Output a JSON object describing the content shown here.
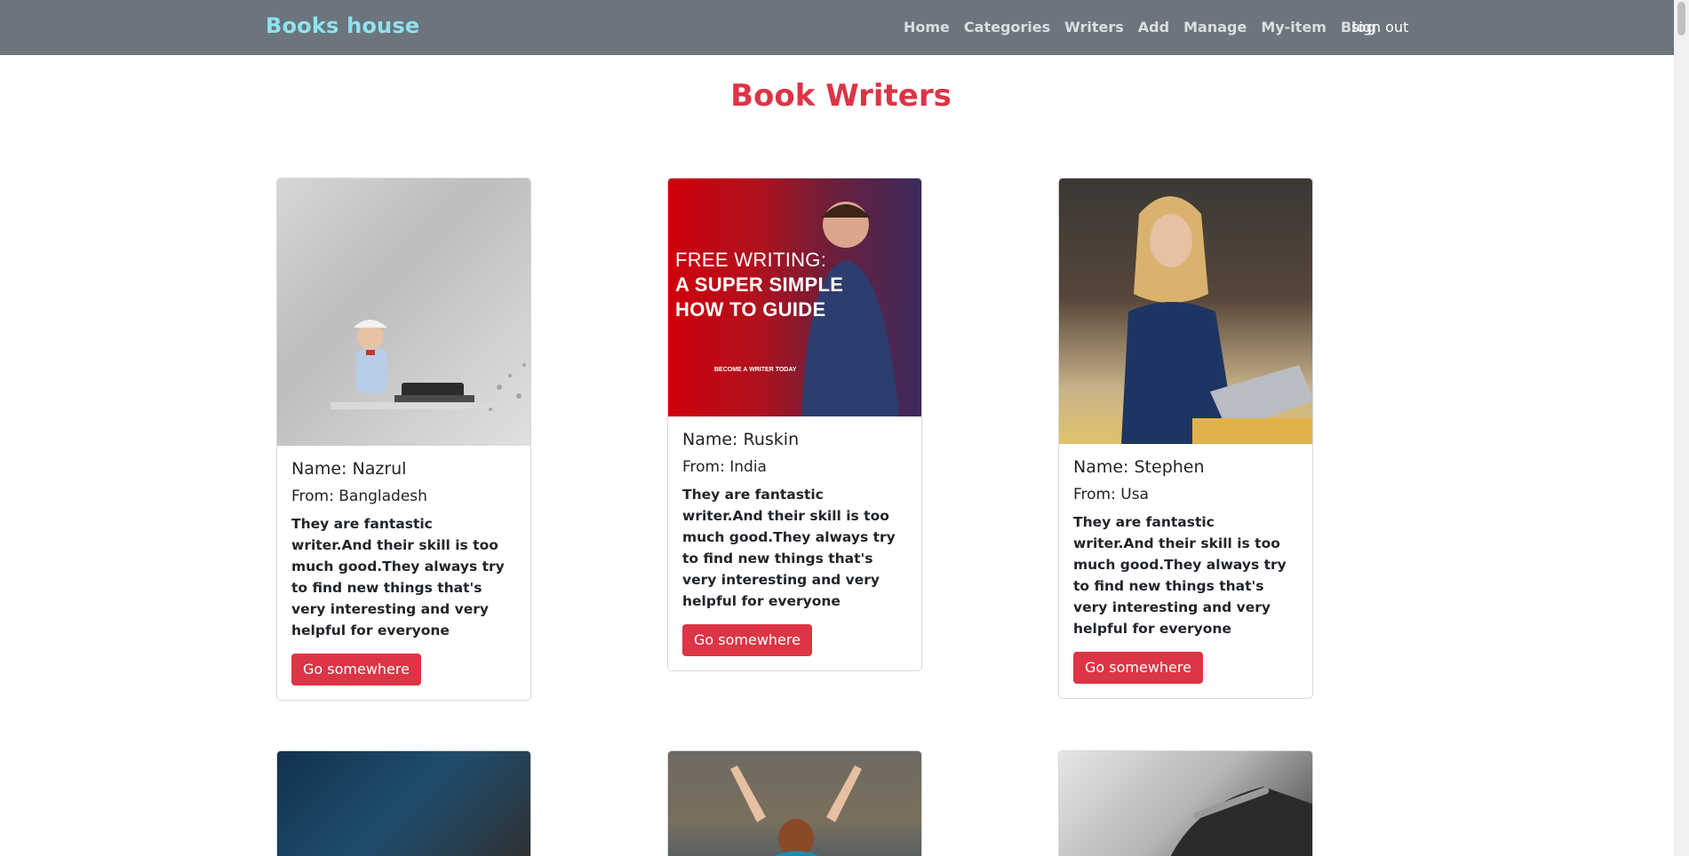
{
  "navbar": {
    "brand": "Books house",
    "links": [
      "Home",
      "Categories",
      "Writers",
      "Add",
      "Manage",
      "My-item",
      "Blog"
    ],
    "signout": "sign out"
  },
  "page": {
    "title": "Book Writers"
  },
  "writers": [
    {
      "name": "Name: Nazrul",
      "from": "From: Bangladesh",
      "text": "They are fantastic writer.And their skill is too much good.They always try to find new things that's very interesting and very helpful for everyone",
      "button": "Go somewhere"
    },
    {
      "name": "Name: Ruskin",
      "from": "From: India",
      "text": "They are fantastic writer.And their skill is too much good.They always try to find new things that's very interesting and very helpful for everyone",
      "button": "Go somewhere",
      "image_text": [
        "FREE WRITING:",
        "A SUPER SIMPLE",
        "HOW TO GUIDE"
      ],
      "image_small_text": "BECOME A WRITER TODAY"
    },
    {
      "name": "Name: Stephen",
      "from": "From: Usa",
      "text": "They are fantastic writer.And their skill is too much good.They always try to find new things that's very interesting and very helpful for everyone",
      "button": "Go somewhere"
    }
  ],
  "colors": {
    "navbar": "#6c757d",
    "brand": "#8ee3ef",
    "accent": "#dc3545"
  }
}
